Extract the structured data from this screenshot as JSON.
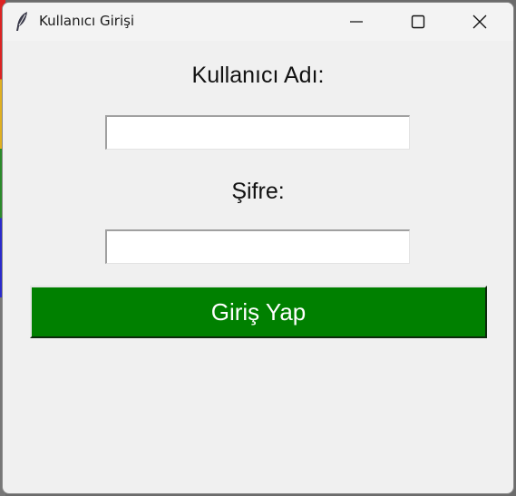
{
  "window": {
    "title": "Kullanıcı Girişi"
  },
  "icons": {
    "app": "feather-icon",
    "minimize": "minimize-icon",
    "maximize": "maximize-icon",
    "close": "close-icon"
  },
  "form": {
    "username_label": "Kullanıcı Adı:",
    "username_value": "",
    "password_label": "Şifre:",
    "password_value": "",
    "login_button_label": "Giriş Yap"
  },
  "colors": {
    "login_button_bg": "#008000",
    "login_button_text": "#ffffff",
    "window_bg": "#f0f0f0"
  }
}
